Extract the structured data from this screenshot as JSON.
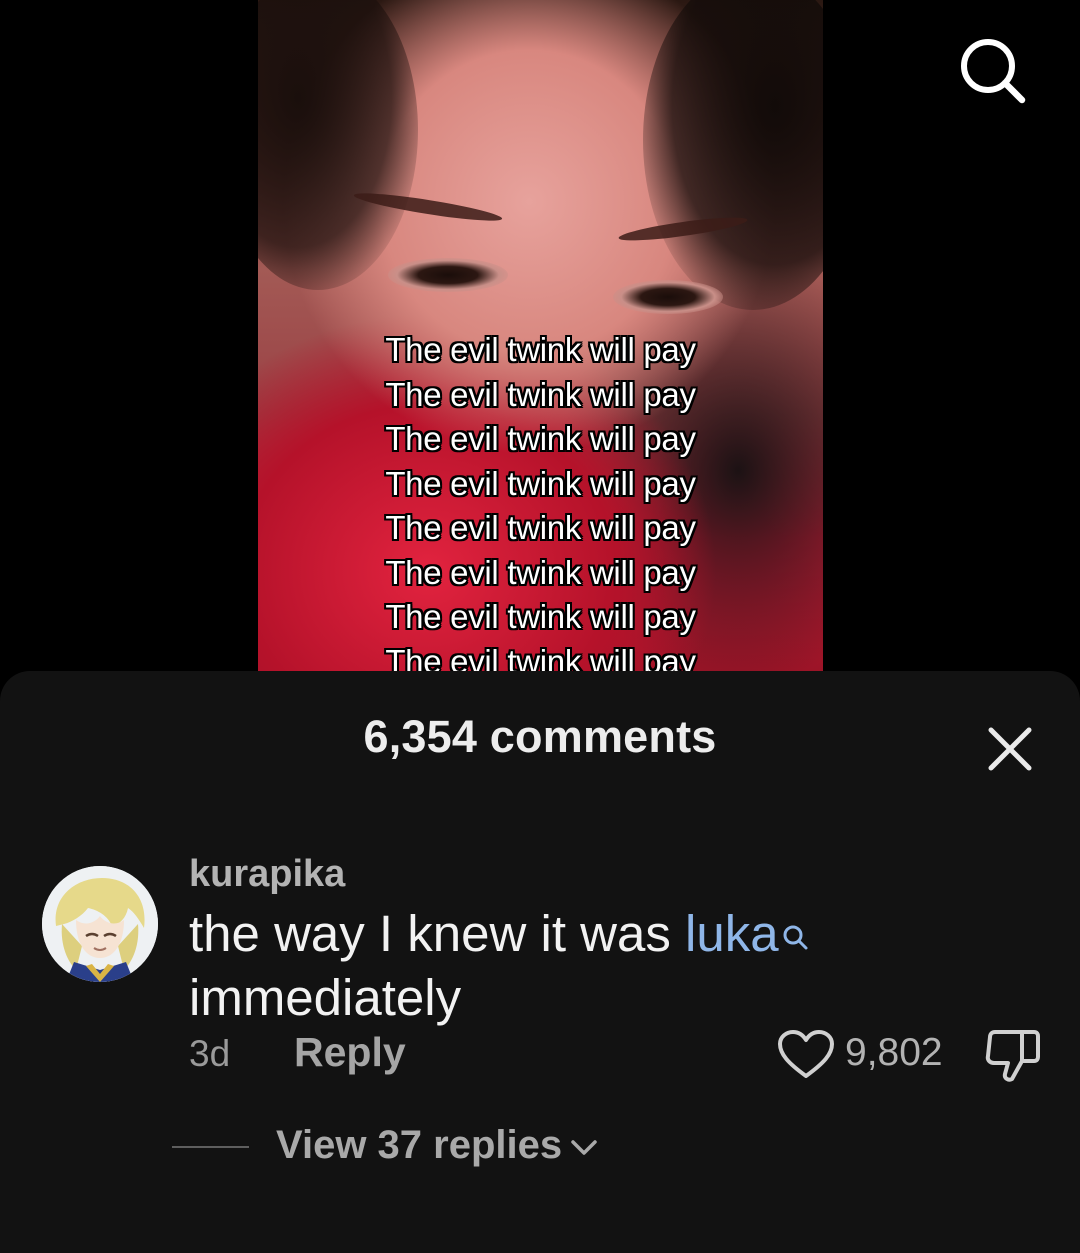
{
  "video": {
    "caption_lines": [
      "The evil twink will pay",
      "The evil twink will pay",
      "The evil twink will pay",
      "The evil twink will pay",
      "The evil twink will pay",
      "The evil twink will pay",
      "The evil twink will pay",
      "The evil twink will pay"
    ]
  },
  "top_bar": {
    "search_icon": "search-icon"
  },
  "comments_sheet": {
    "title": "6,354 comments",
    "close_icon": "close-icon",
    "comments": [
      {
        "username": "kurapika",
        "text_before": "the way I knew it was ",
        "mention": "luka",
        "text_after": "immediately",
        "time": "3d",
        "reply_label": "Reply",
        "likes": "9,802",
        "view_replies_label": "View 37 replies"
      }
    ]
  },
  "colors": {
    "sheet_background": "#121212",
    "mention_link": "#8fb6e8",
    "secondary_text": "#b3b3b3"
  }
}
